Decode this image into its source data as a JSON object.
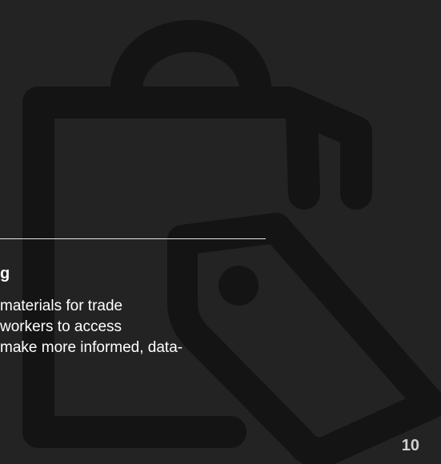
{
  "slide": {
    "background_color": "#232323",
    "heading": "g",
    "body_lines": [
      "materials for trade",
      "workers to access",
      "make more informed, data-"
    ],
    "page_number": "10",
    "icon": "shopping-bag-with-price-tag-icon",
    "icon_color": "#141414"
  }
}
